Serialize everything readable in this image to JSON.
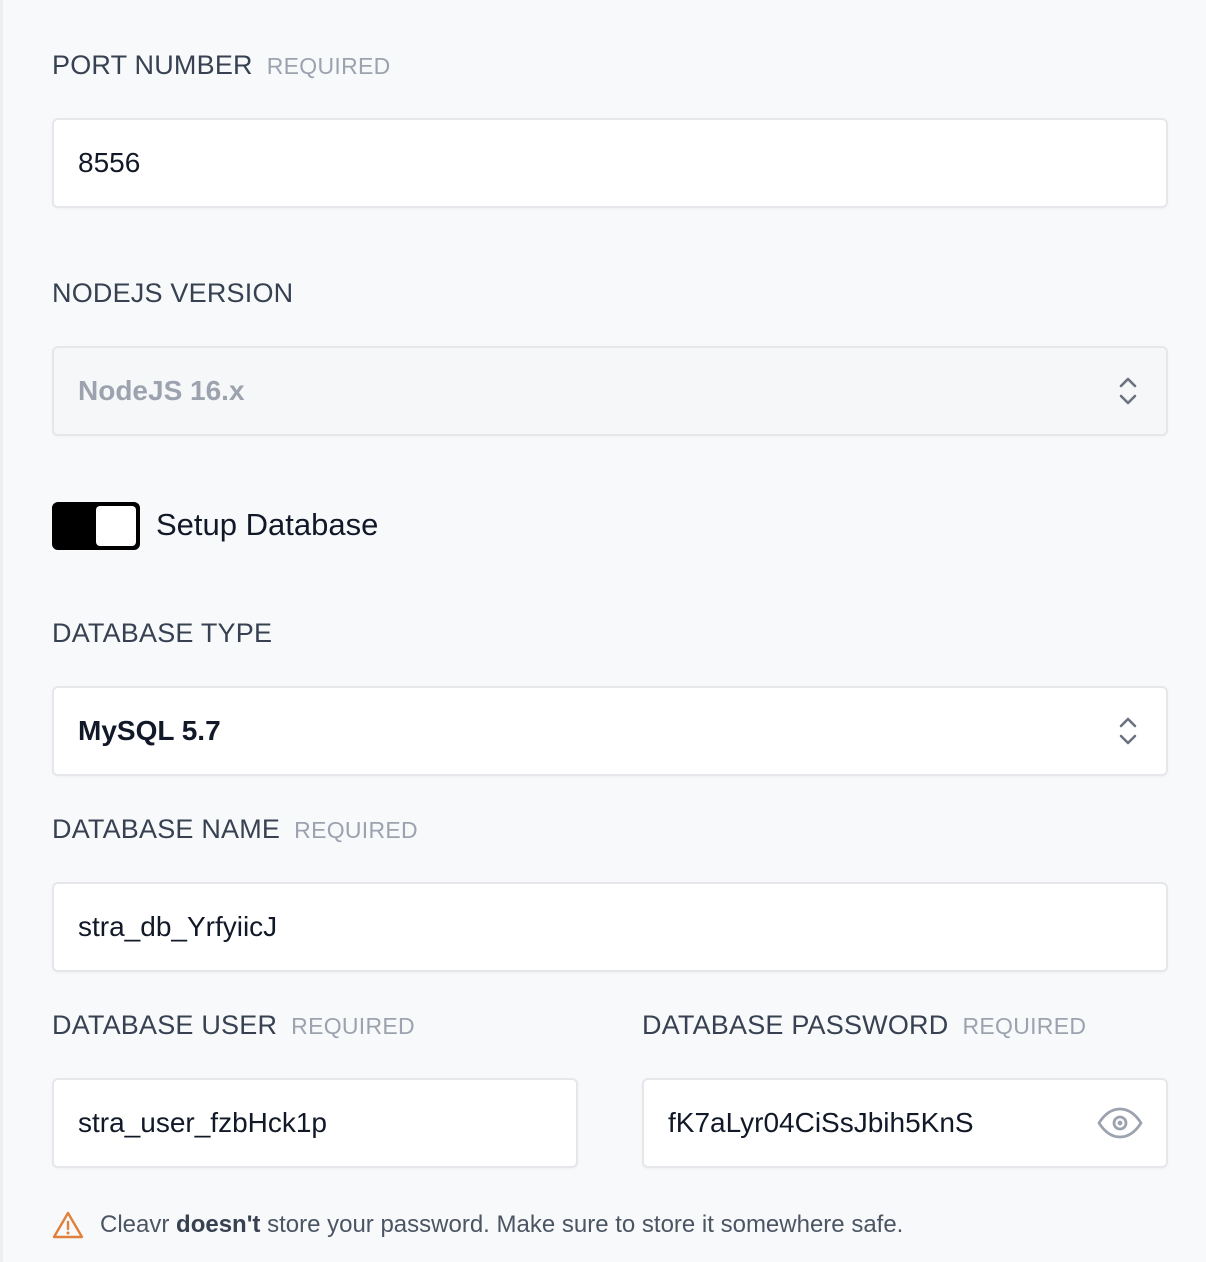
{
  "port": {
    "label": "PORT NUMBER",
    "required": "REQUIRED",
    "value": "8556"
  },
  "nodejs": {
    "label": "NODEJS VERSION",
    "selected": "NodeJS 16.x"
  },
  "setup_database": {
    "label": "Setup Database",
    "enabled": true
  },
  "database_type": {
    "label": "DATABASE TYPE",
    "selected": "MySQL 5.7"
  },
  "database_name": {
    "label": "DATABASE NAME",
    "required": "REQUIRED",
    "value": "stra_db_YrfyiicJ"
  },
  "database_user": {
    "label": "DATABASE USER",
    "required": "REQUIRED",
    "value": "stra_user_fzbHck1p"
  },
  "database_password": {
    "label": "DATABASE PASSWORD",
    "required": "REQUIRED",
    "value": "fK7aLyr04CiSsJbih5KnS"
  },
  "notice": {
    "prefix": "Cleavr",
    "emphasis": "doesn't",
    "suffix": "store your password. Make sure to store it somewhere safe."
  },
  "colors": {
    "warning": "#e0803a",
    "toggle_on": "#000000"
  },
  "icons": {
    "select": "chevron-up-down-icon",
    "reveal": "eye-icon",
    "warning": "warning-triangle-icon"
  }
}
